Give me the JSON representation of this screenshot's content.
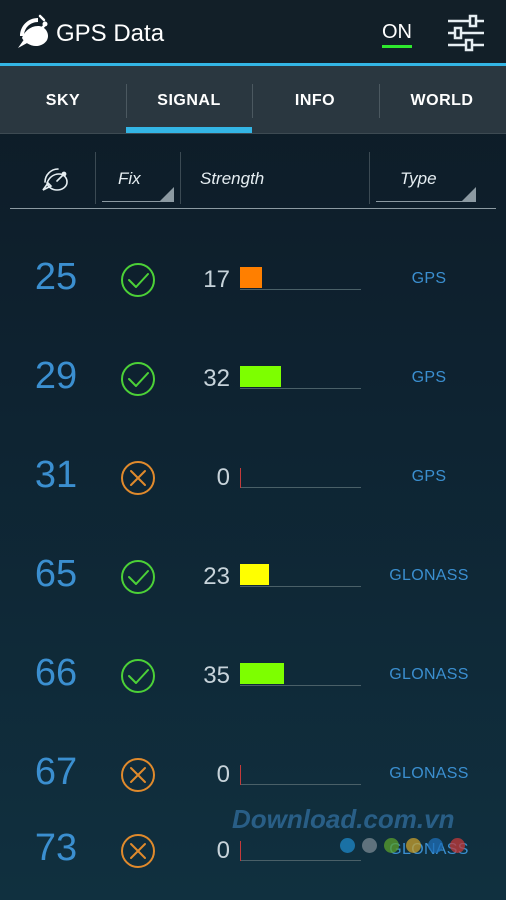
{
  "app": {
    "title": "GPS Data",
    "toggle_label": "ON",
    "colors": {
      "accent": "#33b5e5",
      "toggle_on": "#2ee82e",
      "id_text": "#3b8fd0",
      "fix_ok": "#4cd137",
      "fix_none": "#e08a2c"
    }
  },
  "tabs": [
    {
      "label": "SKY"
    },
    {
      "label": "SIGNAL",
      "selected": true
    },
    {
      "label": "INFO"
    },
    {
      "label": "WORLD"
    }
  ],
  "columns": {
    "sat_icon": "satellite-dish-icon",
    "fix": "Fix",
    "strength": "Strength",
    "type": "Type"
  },
  "rows": [
    {
      "id": "25",
      "fix": true,
      "fix_icon": "check-circle-icon",
      "strength": "17",
      "bar_fraction": 0.18,
      "bar_color": "#ff7f00",
      "type": "GPS"
    },
    {
      "id": "29",
      "fix": true,
      "fix_icon": "check-circle-icon",
      "strength": "32",
      "bar_fraction": 0.34,
      "bar_color": "#7dff00",
      "type": "GPS"
    },
    {
      "id": "31",
      "fix": false,
      "fix_icon": "x-circle-icon",
      "strength": "0",
      "bar_fraction": 0.0,
      "bar_color": "#c43a3a",
      "type": "GPS"
    },
    {
      "id": "65",
      "fix": true,
      "fix_icon": "check-circle-icon",
      "strength": "23",
      "bar_fraction": 0.24,
      "bar_color": "#ffff00",
      "type": "GLONASS"
    },
    {
      "id": "66",
      "fix": true,
      "fix_icon": "check-circle-icon",
      "strength": "35",
      "bar_fraction": 0.36,
      "bar_color": "#7dff00",
      "type": "GLONASS"
    },
    {
      "id": "67",
      "fix": false,
      "fix_icon": "x-circle-icon",
      "strength": "0",
      "bar_fraction": 0.0,
      "bar_color": "#c43a3a",
      "type": "GLONASS"
    },
    {
      "id": "73",
      "fix": false,
      "fix_icon": "x-circle-icon",
      "strength": "0",
      "bar_fraction": 0.0,
      "bar_color": "#c43a3a",
      "type": "GLONASS"
    }
  ],
  "watermark": {
    "text": "Download.com.vn",
    "dot_colors": [
      "#1e88c8",
      "#7a8a93",
      "#5aa02c",
      "#c8a02c",
      "#1e6fb8",
      "#c43a3a"
    ]
  }
}
